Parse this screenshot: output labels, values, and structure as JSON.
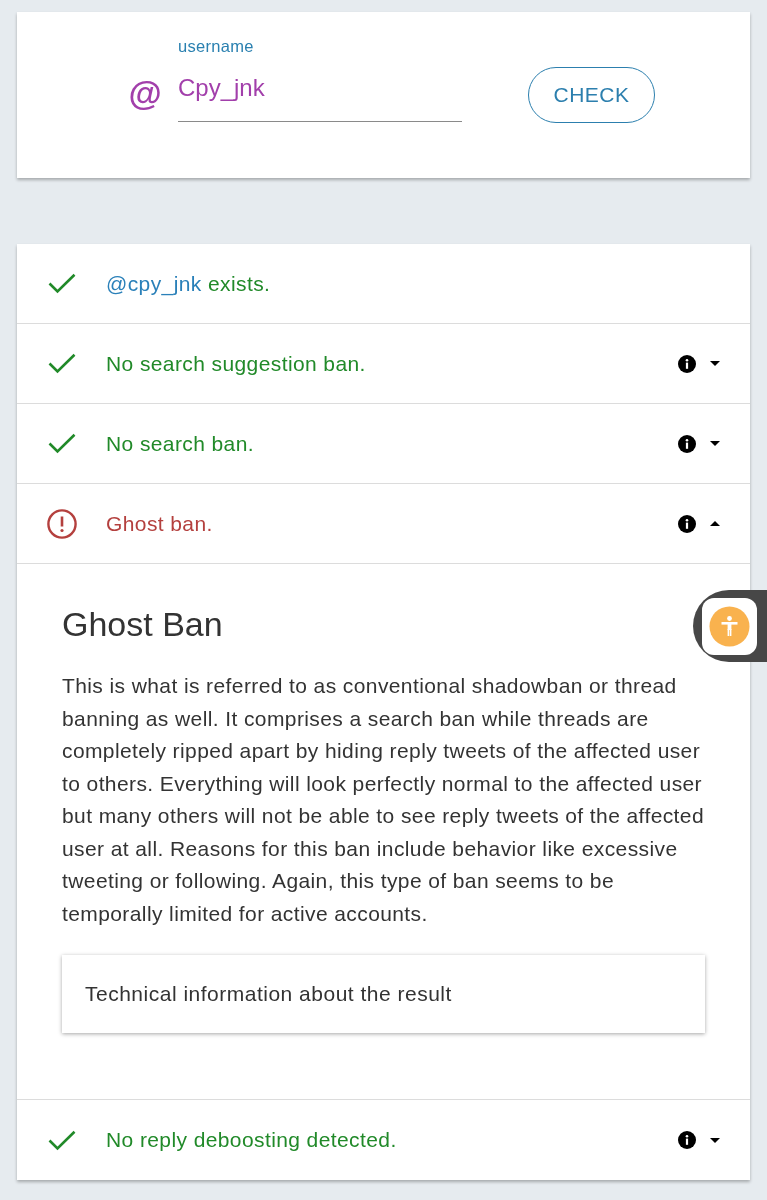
{
  "search": {
    "prefix": "@",
    "label": "username",
    "value": "Cpy_jnk",
    "button": "CHECK"
  },
  "results": [
    {
      "kind": "plain",
      "passed": true,
      "handle": "@cpy_jnk",
      "text": "exists."
    },
    {
      "kind": "expandable",
      "passed": true,
      "text": "No search suggestion ban.",
      "expanded": false
    },
    {
      "kind": "expandable",
      "passed": true,
      "text": "No search ban.",
      "expanded": false
    },
    {
      "kind": "expandable",
      "passed": false,
      "text": "Ghost ban.",
      "expanded": true,
      "detail": {
        "title": "Ghost Ban",
        "body": "This is what is referred to as conventional shadowban or thread banning as well. It comprises a search ban while threads are completely ripped apart by hiding reply tweets of the affected user to others. Everything will look perfectly normal to the affected user but many others will not be able to see reply tweets of the affected user at all. Reasons for this ban include behavior like excessive tweeting or following. Again, this type of ban seems to be temporally limited for active accounts.",
        "technical": "Technical information about the result"
      }
    },
    {
      "kind": "expandable",
      "passed": true,
      "text": "No reply deboosting detected.",
      "expanded": false
    }
  ]
}
